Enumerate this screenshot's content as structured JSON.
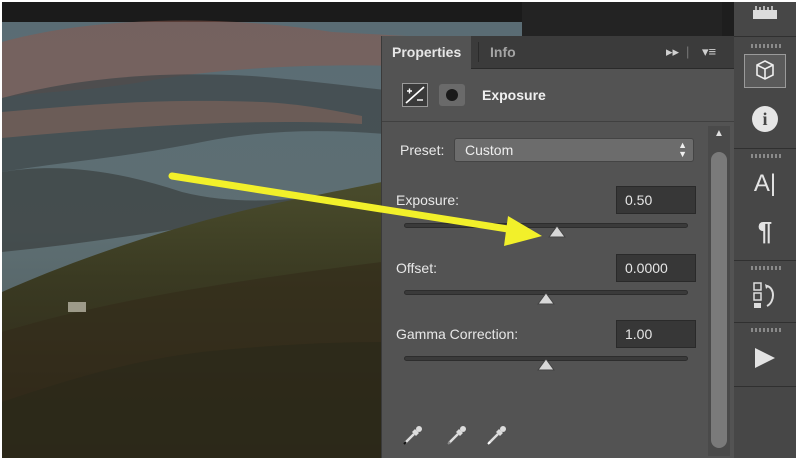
{
  "panel": {
    "tabs": [
      {
        "label": "Properties",
        "active": true
      },
      {
        "label": "Info",
        "active": false
      }
    ],
    "tab_controls": {
      "expand": "▸▸",
      "menu": "▾≡"
    },
    "title": "Exposure",
    "preset": {
      "label": "Preset:",
      "value": "Custom"
    },
    "controls": [
      {
        "label": "Exposure:",
        "value": "0.50",
        "slider": 0.54
      },
      {
        "label": "Offset:",
        "value": "0.0000",
        "slider": 0.5
      },
      {
        "label": "Gamma Correction:",
        "value": "1.00",
        "slider": 0.5
      }
    ]
  },
  "toolbar": {
    "items": [
      "3d-icon",
      "info-icon",
      "character-icon",
      "paragraph-icon",
      "history-icon",
      "actions-play-icon"
    ],
    "text_glyph": "A|",
    "para_glyph": "¶",
    "info_glyph": "i"
  },
  "annotation": {
    "color": "#f2f02a",
    "type": "arrow"
  },
  "colors": {
    "panel": "#535353",
    "tabbar": "#3b3b3b",
    "field": "#373737",
    "accent": "#f2f02a"
  }
}
